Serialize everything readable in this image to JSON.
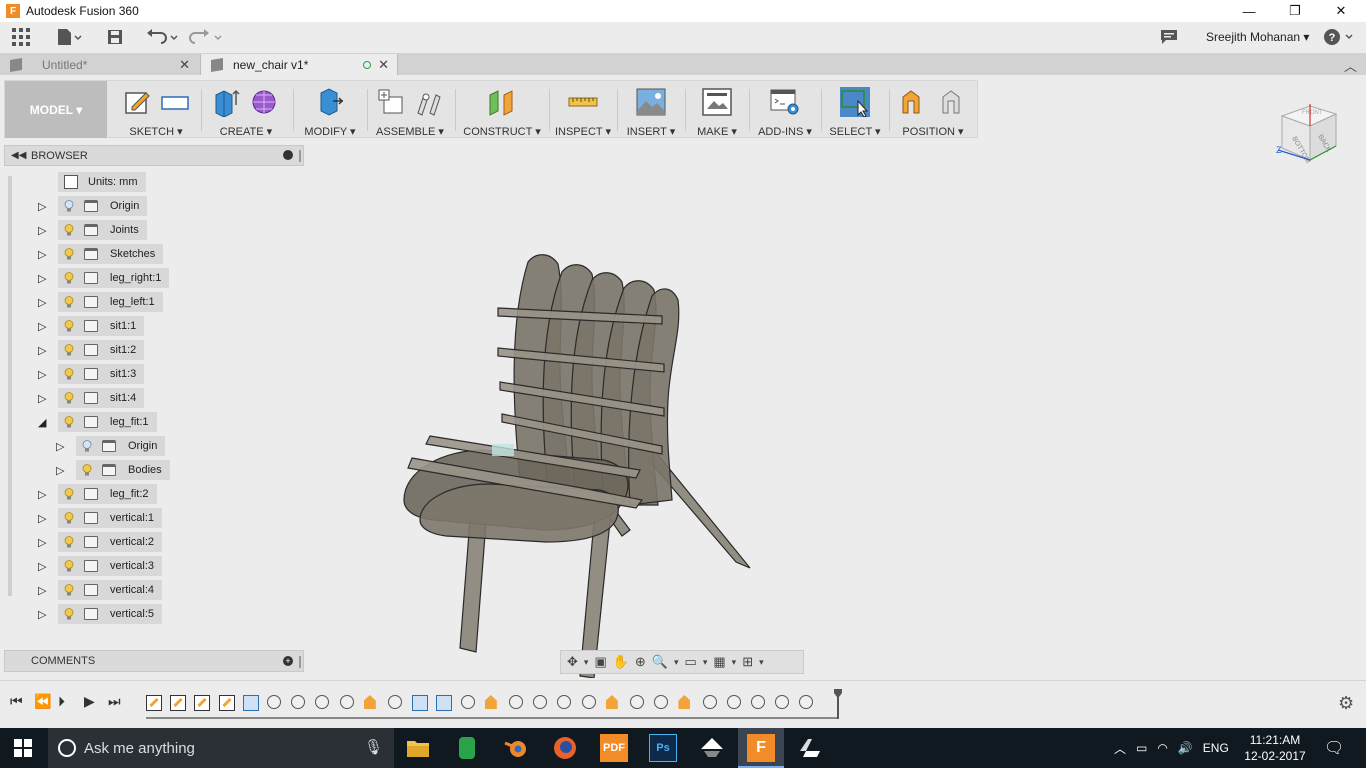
{
  "window": {
    "title": "Autodesk Fusion 360",
    "minimize": "—",
    "maximize": "❐",
    "close": "✕"
  },
  "qab": {
    "user": "Sreejith Mohanan ▾",
    "help": "?"
  },
  "tabs": [
    {
      "label": "Untitled*",
      "active": false
    },
    {
      "label": "new_chair v1*",
      "active": true
    }
  ],
  "ribbon": {
    "workspace": "MODEL ▾",
    "groups": [
      {
        "label": "SKETCH ▾"
      },
      {
        "label": "CREATE ▾"
      },
      {
        "label": "MODIFY ▾"
      },
      {
        "label": "ASSEMBLE ▾"
      },
      {
        "label": "CONSTRUCT ▾"
      },
      {
        "label": "INSPECT ▾"
      },
      {
        "label": "INSERT ▾"
      },
      {
        "label": "MAKE ▾"
      },
      {
        "label": "ADD-INS ▾"
      },
      {
        "label": "SELECT ▾"
      },
      {
        "label": "POSITION ▾"
      }
    ]
  },
  "browser": {
    "title": "BROWSER",
    "items": [
      {
        "label": "Units: mm",
        "type": "units"
      },
      {
        "label": "Origin",
        "type": "folder",
        "bulb": "off"
      },
      {
        "label": "Joints",
        "type": "folder",
        "bulb": "on"
      },
      {
        "label": "Sketches",
        "type": "folder",
        "bulb": "on"
      },
      {
        "label": "leg_right:1",
        "type": "component",
        "bulb": "on"
      },
      {
        "label": "leg_left:1",
        "type": "component",
        "bulb": "on"
      },
      {
        "label": "sit1:1",
        "type": "component",
        "bulb": "on"
      },
      {
        "label": "sit1:2",
        "type": "component",
        "bulb": "on"
      },
      {
        "label": "sit1:3",
        "type": "component",
        "bulb": "on"
      },
      {
        "label": "sit1:4",
        "type": "component",
        "bulb": "on"
      },
      {
        "label": "leg_fit:1",
        "type": "component",
        "bulb": "on",
        "expanded": true
      },
      {
        "label": "Origin",
        "type": "folder",
        "bulb": "off",
        "child": true
      },
      {
        "label": "Bodies",
        "type": "folder",
        "bulb": "on",
        "child": true
      },
      {
        "label": "leg_fit:2",
        "type": "component",
        "bulb": "on"
      },
      {
        "label": "vertical:1",
        "type": "component",
        "bulb": "on"
      },
      {
        "label": "vertical:2",
        "type": "component",
        "bulb": "on"
      },
      {
        "label": "vertical:3",
        "type": "component",
        "bulb": "on"
      },
      {
        "label": "vertical:4",
        "type": "component",
        "bulb": "on"
      },
      {
        "label": "vertical:5",
        "type": "component",
        "bulb": "on"
      }
    ]
  },
  "comments": {
    "title": "COMMENTS"
  },
  "viewcube": {
    "faces": [
      "FRONT",
      "BACK",
      "BOTTOM"
    ],
    "axis_z": "Z"
  },
  "taskbar": {
    "search_placeholder": "Ask me anything",
    "apps": [
      {
        "name": "file-explorer",
        "label": ""
      },
      {
        "name": "green-app",
        "label": ""
      },
      {
        "name": "blender",
        "label": ""
      },
      {
        "name": "firefox",
        "label": ""
      },
      {
        "name": "pdf",
        "label": "PDF"
      },
      {
        "name": "photoshop",
        "label": "Ps"
      },
      {
        "name": "inkscape",
        "label": ""
      },
      {
        "name": "fusion360",
        "label": "F"
      },
      {
        "name": "cnc-app",
        "label": ""
      }
    ],
    "lang": "ENG",
    "time": "11:21:AM",
    "date": "12-02-2017"
  }
}
